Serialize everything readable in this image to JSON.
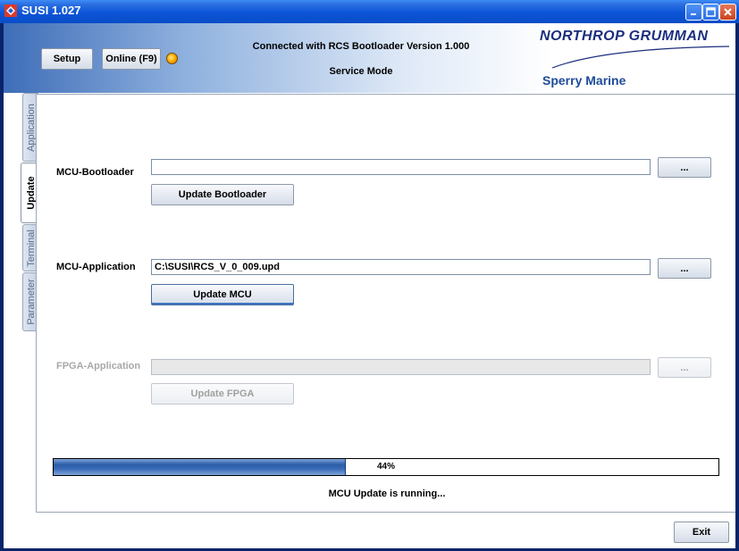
{
  "window": {
    "title": "SUSI 1.027",
    "minimize_icon": "minimize-icon",
    "maximize_icon": "maximize-icon",
    "close_icon": "close-icon"
  },
  "header": {
    "setup_label": "Setup",
    "online_label": "Online (F9)",
    "status_color": "#ffb000",
    "connection_text": "Connected with RCS Bootloader Version 1.000",
    "mode_text": "Service Mode",
    "logo_company": "NORTHROP GRUMMAN",
    "logo_division": "Sperry Marine"
  },
  "tabs": [
    {
      "label": "Application",
      "active": false
    },
    {
      "label": "Update",
      "active": true
    },
    {
      "label": "Terminal",
      "active": false
    },
    {
      "label": "Parameter",
      "active": false
    }
  ],
  "update": {
    "bootloader": {
      "label": "MCU-Bootloader",
      "value": "",
      "browse_label": "...",
      "action_label": "Update Bootloader"
    },
    "application": {
      "label": "MCU-Application",
      "value": "C:\\SUSI\\RCS_V_0_009.upd",
      "browse_label": "...",
      "action_label": "Update MCU"
    },
    "fpga": {
      "label": "FPGA-Application",
      "value": "",
      "browse_label": "...",
      "action_label": "Update FPGA"
    },
    "progress": {
      "percent": 44,
      "text": "44%"
    },
    "status_text": "MCU Update is running..."
  },
  "footer": {
    "exit_label": "Exit"
  }
}
